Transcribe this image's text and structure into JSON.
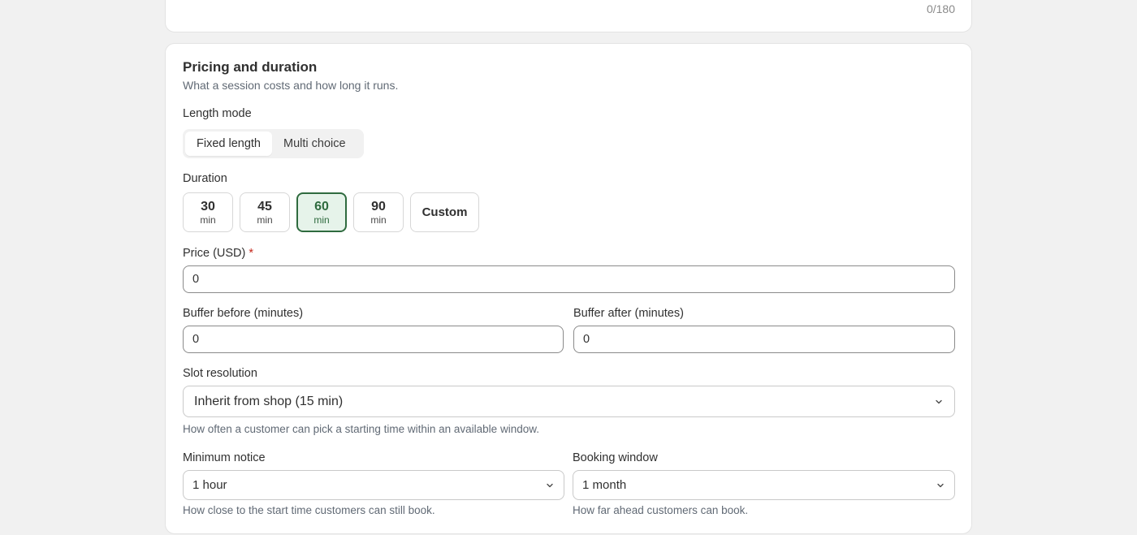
{
  "top_card": {
    "counter": "0/180"
  },
  "section": {
    "title": "Pricing and duration",
    "subtitle": "What a session costs and how long it runs."
  },
  "length_mode": {
    "label": "Length mode",
    "options": [
      "Fixed length",
      "Multi choice"
    ],
    "selected": "Fixed length"
  },
  "duration": {
    "label": "Duration",
    "options": [
      {
        "value": "30",
        "unit": "min"
      },
      {
        "value": "45",
        "unit": "min"
      },
      {
        "value": "60",
        "unit": "min"
      },
      {
        "value": "90",
        "unit": "min"
      }
    ],
    "custom_label": "Custom",
    "selected": "60"
  },
  "price": {
    "label": "Price (USD)",
    "required_mark": "*",
    "value": "0"
  },
  "buffer_before": {
    "label": "Buffer before (minutes)",
    "value": "0"
  },
  "buffer_after": {
    "label": "Buffer after (minutes)",
    "value": "0"
  },
  "slot_resolution": {
    "label": "Slot resolution",
    "value": "Inherit from shop (15 min)",
    "help": "How often a customer can pick a starting time within an available window."
  },
  "minimum_notice": {
    "label": "Minimum notice",
    "value": "1 hour",
    "help": "How close to the start time customers can still book."
  },
  "booking_window": {
    "label": "Booking window",
    "value": "1 month",
    "help": "How far ahead customers can book."
  },
  "colors": {
    "accent": "#2f6b3f",
    "accent_bg": "#e6f3ea",
    "required": "#c5281c"
  },
  "icons": {
    "dropdown": "chevron-down-icon"
  }
}
